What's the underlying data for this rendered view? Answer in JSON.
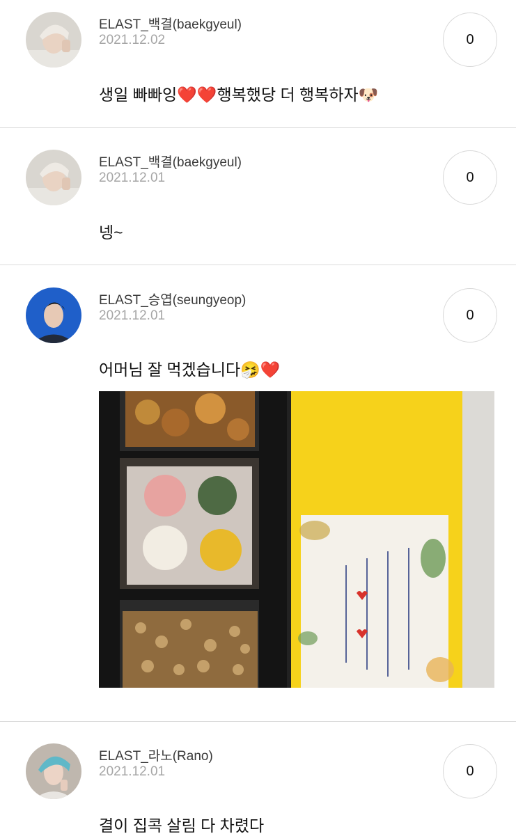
{
  "posts": [
    {
      "username": "ELAST_백결(baekgyeul)",
      "date": "2021.12.02",
      "text": "생일 빠빠잉❤️❤️행복했당 더 행복하자🐶",
      "count": "0",
      "avatar_color": "#cfcbc4"
    },
    {
      "username": "ELAST_백결(baekgyeul)",
      "date": "2021.12.01",
      "text": "넹~",
      "count": "0",
      "avatar_color": "#cfcbc4"
    },
    {
      "username": "ELAST_승엽(seungyeop)",
      "date": "2021.12.01",
      "text": "어머님 잘 먹겠습니다🤧❤️",
      "count": "0",
      "avatar_color": "#1f5fc9"
    },
    {
      "username": "ELAST_라노(Rano)",
      "date": "2021.12.01",
      "text": "결이 집콕 살림 다 차렸다",
      "count": "0",
      "avatar_color": "#6bb6c4"
    }
  ],
  "colors": {
    "divider": "#dcdcdc",
    "date_text": "#a6a6a6",
    "gift_box_yellow": "#f6d21b"
  }
}
